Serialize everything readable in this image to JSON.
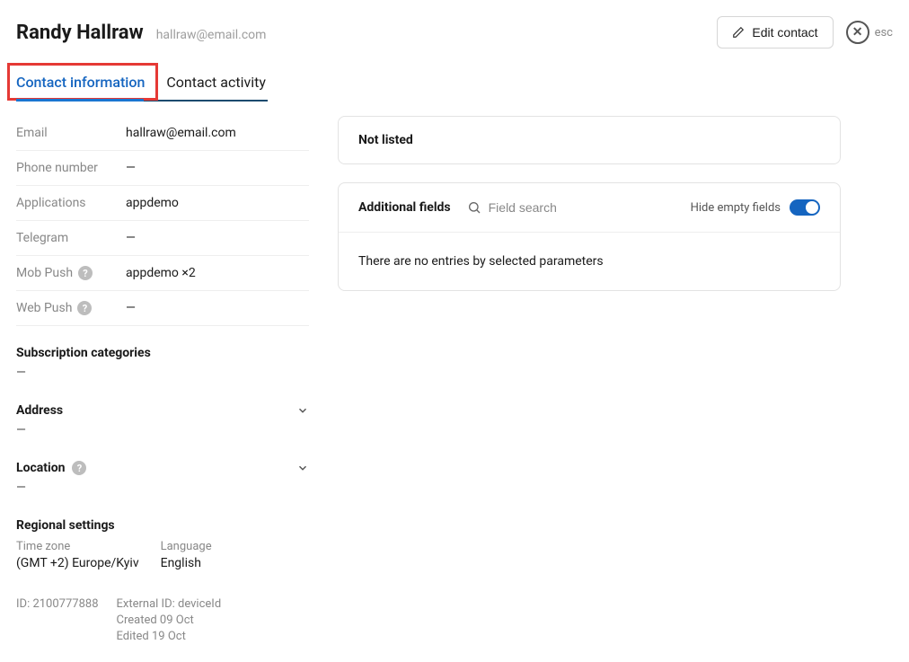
{
  "header": {
    "name": "Randy Hallraw",
    "email": "hallraw@email.com",
    "edit_label": "Edit contact",
    "esc_label": "esc"
  },
  "tabs": {
    "info": "Contact information",
    "activity": "Contact activity"
  },
  "info": {
    "email_label": "Email",
    "email_value": "hallraw@email.com",
    "phone_label": "Phone number",
    "phone_value": "—",
    "apps_label": "Applications",
    "apps_value": "appdemo",
    "telegram_label": "Telegram",
    "telegram_value": "—",
    "mobpush_label": "Mob Push",
    "mobpush_value": "appdemo ×2",
    "webpush_label": "Web Push",
    "webpush_value": "—"
  },
  "subscription": {
    "title": "Subscription categories",
    "value": "—"
  },
  "address": {
    "title": "Address",
    "value": "—"
  },
  "location": {
    "title": "Location",
    "value": "—"
  },
  "regional": {
    "title": "Regional settings",
    "tz_label": "Time zone",
    "tz_value": "(GMT +2) Europe/Kyiv",
    "lang_label": "Language",
    "lang_value": "English"
  },
  "meta": {
    "id_label": "ID: 2100777888",
    "external": "External ID: deviceId",
    "created": "Created 09 Oct",
    "edited": "Edited 19 Oct"
  },
  "right": {
    "not_listed": "Not listed",
    "af_title": "Additional fields",
    "search_placeholder": "Field search",
    "hide_label": "Hide empty fields",
    "no_entries": "There are no entries by selected parameters"
  }
}
